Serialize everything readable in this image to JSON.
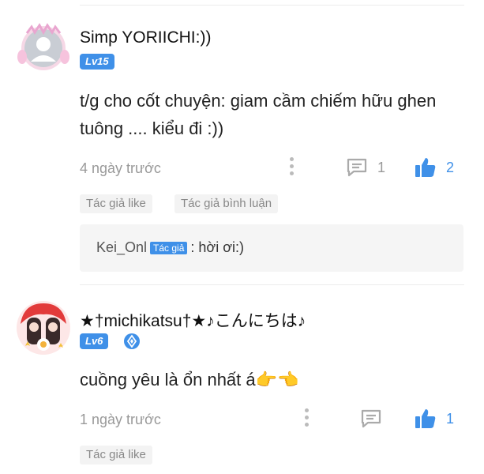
{
  "comments": [
    {
      "username": "Simp YORIICHI:))",
      "level": "Lv15",
      "content": "t/g cho cốt chuyện: giam cầm chiếm hữu ghen tuông .... kiểu đi :))",
      "time": "4 ngày trước",
      "comment_count": "1",
      "like_count": "2",
      "tags": [
        "Tác giả like",
        "Tác giả bình luận"
      ],
      "reply": {
        "user": "Kei_Onl",
        "badge": "Tác giả",
        "text": ": hời ơi:)"
      }
    },
    {
      "username": "★†michikatsu†★♪こんにちは♪",
      "level": "Lv6",
      "content": "cuồng yêu là ổn nhất á👉👈",
      "time": "1 ngày trước",
      "like_count": "1",
      "tags": [
        "Tác giả like"
      ]
    }
  ],
  "colors": {
    "accent": "#3f90e8",
    "muted": "#999999",
    "tag_bg": "#f3f3f3",
    "reply_bg": "#f5f5f5"
  }
}
